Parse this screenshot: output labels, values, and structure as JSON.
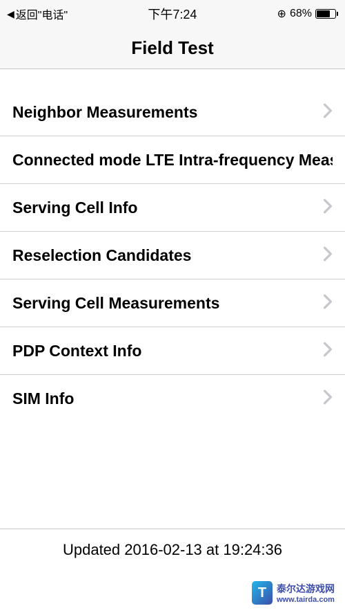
{
  "status_bar": {
    "back_text": "返回\"电话\"",
    "time": "下午7:24",
    "battery_pct": "68%"
  },
  "nav": {
    "title": "Field Test"
  },
  "list": {
    "items": [
      {
        "label": "Neighbor Measurements"
      },
      {
        "label": "Connected mode LTE Intra-frequency Meas"
      },
      {
        "label": "Serving Cell Info"
      },
      {
        "label": "Reselection Candidates"
      },
      {
        "label": "Serving Cell Measurements"
      },
      {
        "label": "PDP Context Info"
      },
      {
        "label": "SIM Info"
      }
    ]
  },
  "footer": {
    "updated": "Updated 2016-02-13 at 19:24:36"
  },
  "watermark": {
    "badge": "T",
    "site": "泰尔达游戏网",
    "url": "www.tairda.com"
  }
}
